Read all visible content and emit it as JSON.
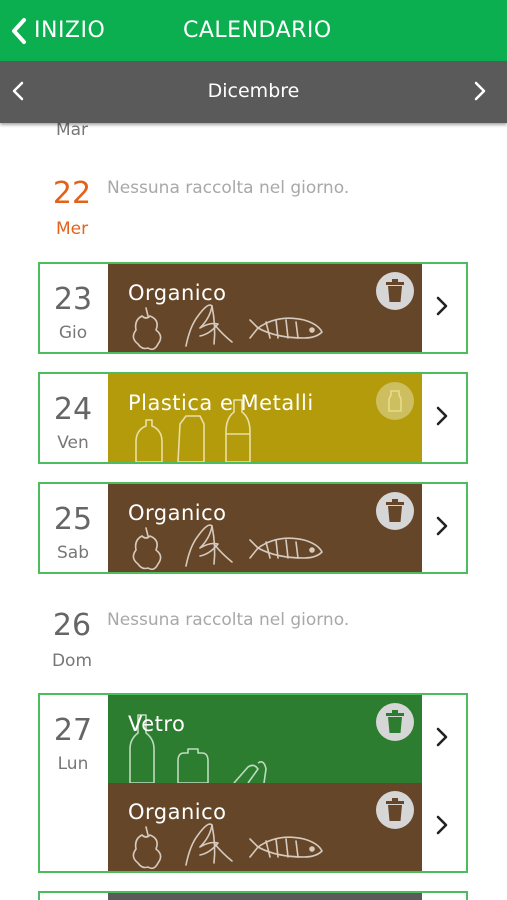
{
  "header": {
    "back_label": "INIZIO",
    "title": "CALENDARIO"
  },
  "month_bar": {
    "label": "Dicembre"
  },
  "colors": {
    "green": "#0baf4f",
    "organico": "#664628",
    "plastica": "#b39b0c",
    "vetro": "#2d7d30",
    "accent": "#e2621b"
  },
  "days": [
    {
      "num": "",
      "name": "Mar"
    },
    {
      "num": "22",
      "name": "Mer",
      "note": "Nessuna raccolta nel giorno."
    },
    {
      "num": "23",
      "name": "Gio",
      "collections": [
        {
          "label": "Organico",
          "icon": "trash-icon"
        }
      ]
    },
    {
      "num": "24",
      "name": "Ven",
      "collections": [
        {
          "label": "Plastica e Metalli",
          "icon": "trash-icon"
        }
      ]
    },
    {
      "num": "25",
      "name": "Sab",
      "collections": [
        {
          "label": "Organico",
          "icon": "trash-icon"
        }
      ]
    },
    {
      "num": "26",
      "name": "Dom",
      "note": "Nessuna raccolta nel giorno."
    },
    {
      "num": "27",
      "name": "Lun",
      "collections": [
        {
          "label": "Vetro",
          "icon": "trash-icon"
        },
        {
          "label": "Organico",
          "icon": "trash-icon"
        }
      ]
    }
  ]
}
